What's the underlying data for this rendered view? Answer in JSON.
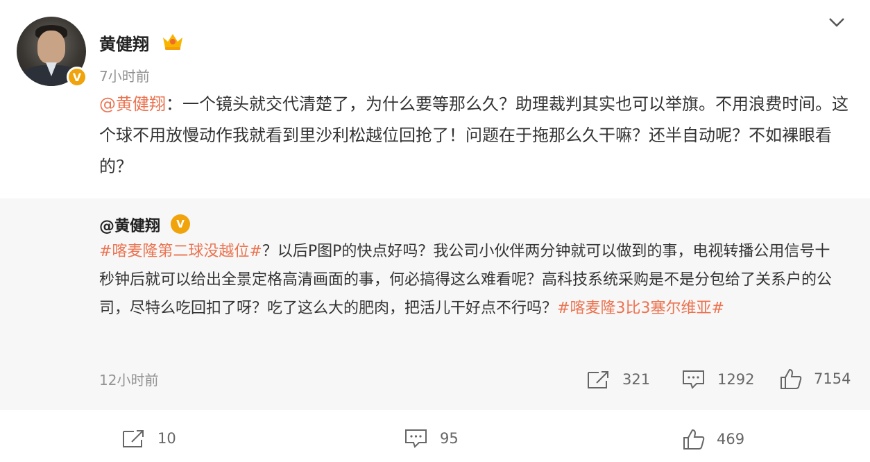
{
  "post": {
    "author": "黄健翔",
    "time": "7小时前",
    "mention": "@黄健翔",
    "text": "：一个镜头就交代清楚了，为什么要等那么久？助理裁判其实也可以举旗。不用浪费时间。这个球不用放慢动作我就看到里沙利松越位回抢了！问题在于拖那么久干嘛？还半自动呢？不如裸眼看的？",
    "verified_badge": "V"
  },
  "quoted": {
    "author": "@黄健翔",
    "tag1": "#喀麦隆第二球没越位#",
    "text": "？以后P图P的快点好吗？我公司小伙伴两分钟就可以做到的事，电视转播公用信号十秒钟后就可以给出全景定格高清画面的事，何必搞得这么难看呢？高科技系统采购是不是分包给了关系户的公司，尽特么吃回扣了呀？吃了这么大的肥肉，把活儿干好点不行吗？",
    "tag2": "#喀麦隆3比3塞尔维亚#",
    "time": "12小时前",
    "repost_count": "321",
    "comment_count": "1292",
    "like_count": "7154",
    "verified_badge": "V"
  },
  "footer": {
    "repost_count": "10",
    "comment_count": "95",
    "like_count": "469"
  },
  "colors": {
    "accent": "#eb7350",
    "badge": "#f0a30a",
    "quote_bg": "#f7f7f7",
    "meta": "#939393"
  },
  "icons": [
    "crown-icon",
    "chevron-down-icon",
    "repost-icon",
    "comment-icon",
    "like-icon",
    "verified-badge-icon"
  ]
}
